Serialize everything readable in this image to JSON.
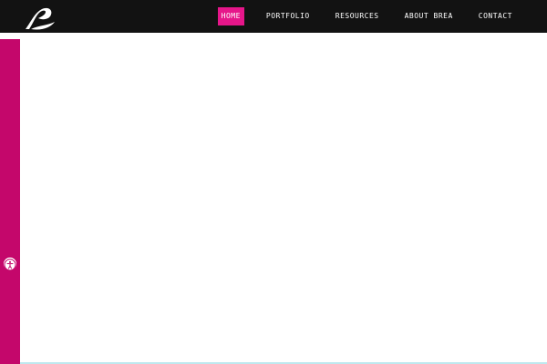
{
  "header": {
    "logo_icon": "brea-logo-icon",
    "nav": [
      {
        "label": "HOME",
        "active": true
      },
      {
        "label": "PORTFOLIO",
        "active": false
      },
      {
        "label": "RESOURCES",
        "active": false
      },
      {
        "label": "ABOUT BREA",
        "active": false
      },
      {
        "label": "CONTACT",
        "active": false
      }
    ]
  },
  "sidebar": {
    "accessibility_icon": "accessibility-icon"
  },
  "colors": {
    "topbar": "#121212",
    "accent_active": "#e6168a",
    "sidebar": "#c4076b",
    "bottom_line": "#bfe8ee"
  }
}
